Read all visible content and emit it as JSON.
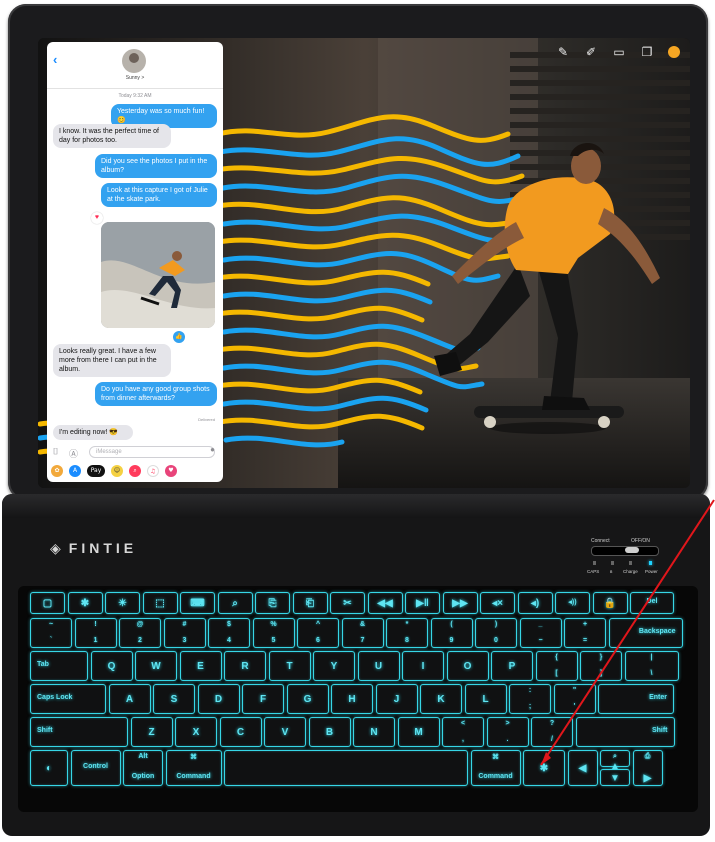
{
  "messages": {
    "contact_name": "Sunny >",
    "timestamp": "Today 9:32 AM",
    "bubbles": [
      {
        "text": "Yesterday was so much fun! 😊",
        "dir": "out"
      },
      {
        "text": "I know. It was the perfect time of day for photos too.",
        "dir": "in"
      },
      {
        "text": "Did you see the photos I put in the album?",
        "dir": "out"
      },
      {
        "text": "Look at this capture I got of Julie at the skate park.",
        "dir": "out"
      },
      {
        "text": "Looks really great. I have a few more from there I can put in the album.",
        "dir": "in"
      },
      {
        "text": "Do you have any good group shots from dinner afterwards?",
        "dir": "out"
      },
      {
        "text": "I'm editing now! 😎",
        "dir": "in"
      }
    ],
    "delivered": "Delivered",
    "compose_placeholder": "iMessage",
    "apps": [
      "photos-app",
      "app-store-app",
      "apple-pay-app",
      "memoji-app",
      "search-app",
      "music-app",
      "hearts-app"
    ],
    "apple_pay_label": "Pay"
  },
  "keyboard": {
    "brand": "FINTIE",
    "switch": {
      "connect": "Connect",
      "off_on": "OFF/ON"
    },
    "indicators": [
      "CAPS",
      "ʙ",
      "Charge",
      "Power"
    ],
    "rows": [
      [
        {
          "id": "f-home",
          "label": "▢"
        },
        {
          "id": "f-bright-down",
          "label": "✱"
        },
        {
          "id": "f-bright-up",
          "label": "☀"
        },
        {
          "id": "f-select",
          "label": "⬚"
        },
        {
          "id": "f-keyboard",
          "label": "⌨"
        },
        {
          "id": "f-search",
          "label": "⌕"
        },
        {
          "id": "f-copy",
          "label": "⎘"
        },
        {
          "id": "f-paste",
          "label": "⎗"
        },
        {
          "id": "f-cut",
          "label": "✂"
        },
        {
          "id": "f-prev",
          "label": "◀◀"
        },
        {
          "id": "f-play",
          "label": "▶‖"
        },
        {
          "id": "f-next",
          "label": "▶▶"
        },
        {
          "id": "f-mute",
          "label": "◂×"
        },
        {
          "id": "f-vol-down",
          "label": "◂)"
        },
        {
          "id": "f-vol-up",
          "label": "◂))"
        },
        {
          "id": "f-lock",
          "label": "🔒"
        },
        {
          "id": "del",
          "label": "Del"
        }
      ],
      [
        {
          "id": "backtick",
          "top": "~",
          "bot": "`"
        },
        {
          "id": "1",
          "top": "!",
          "bot": "1"
        },
        {
          "id": "2",
          "top": "@",
          "bot": "2"
        },
        {
          "id": "3",
          "top": "#",
          "bot": "3"
        },
        {
          "id": "4",
          "top": "$",
          "bot": "4"
        },
        {
          "id": "5",
          "top": "%",
          "bot": "5"
        },
        {
          "id": "6",
          "top": "^",
          "bot": "6"
        },
        {
          "id": "7",
          "top": "&",
          "bot": "7"
        },
        {
          "id": "8",
          "top": "*",
          "bot": "8"
        },
        {
          "id": "9",
          "top": "(",
          "bot": "9"
        },
        {
          "id": "0",
          "top": ")",
          "bot": "0"
        },
        {
          "id": "minus",
          "top": "_",
          "bot": "−"
        },
        {
          "id": "equal",
          "top": "+",
          "bot": "="
        },
        {
          "id": "backspace",
          "label": "Backspace"
        }
      ],
      [
        {
          "id": "tab",
          "label": "Tab"
        },
        {
          "id": "q",
          "label": "Q"
        },
        {
          "id": "w",
          "label": "W"
        },
        {
          "id": "e",
          "label": "E"
        },
        {
          "id": "r",
          "label": "R"
        },
        {
          "id": "t",
          "label": "T"
        },
        {
          "id": "y",
          "label": "Y"
        },
        {
          "id": "u",
          "label": "U"
        },
        {
          "id": "i",
          "label": "I"
        },
        {
          "id": "o",
          "label": "O"
        },
        {
          "id": "p",
          "label": "P"
        },
        {
          "id": "lbrace",
          "top": "{",
          "bot": "["
        },
        {
          "id": "rbrace",
          "top": "}",
          "bot": "]"
        },
        {
          "id": "pipe",
          "top": "|",
          "bot": "\\"
        }
      ],
      [
        {
          "id": "caps",
          "label": "Caps Lock"
        },
        {
          "id": "a",
          "label": "A"
        },
        {
          "id": "s",
          "label": "S"
        },
        {
          "id": "d",
          "label": "D"
        },
        {
          "id": "f",
          "label": "F"
        },
        {
          "id": "g",
          "label": "G"
        },
        {
          "id": "h",
          "label": "H"
        },
        {
          "id": "j",
          "label": "J"
        },
        {
          "id": "k",
          "label": "K"
        },
        {
          "id": "l",
          "label": "L"
        },
        {
          "id": "semicolon",
          "top": ":",
          "bot": ";"
        },
        {
          "id": "quote",
          "top": "\"",
          "bot": "'"
        },
        {
          "id": "enter",
          "label": "Enter"
        }
      ],
      [
        {
          "id": "lshift",
          "label": "Shift"
        },
        {
          "id": "z",
          "label": "Z"
        },
        {
          "id": "x",
          "label": "X"
        },
        {
          "id": "c",
          "label": "C"
        },
        {
          "id": "v",
          "label": "V"
        },
        {
          "id": "b",
          "label": "B"
        },
        {
          "id": "n",
          "label": "N"
        },
        {
          "id": "m",
          "label": "M"
        },
        {
          "id": "comma",
          "top": "<",
          "bot": ","
        },
        {
          "id": "period",
          "top": ">",
          "bot": "."
        },
        {
          "id": "slash",
          "top": "?",
          "bot": "/"
        },
        {
          "id": "rshift",
          "label": "Shift"
        }
      ],
      [
        {
          "id": "fn",
          "label": "◐"
        },
        {
          "id": "control",
          "label": "Control"
        },
        {
          "id": "option",
          "label": "Option",
          "top": "Alt"
        },
        {
          "id": "lcommand",
          "label": "Command",
          "top": "⌘"
        },
        {
          "id": "space",
          "label": ""
        },
        {
          "id": "rcommand",
          "label": "Command",
          "top": "⌘"
        },
        {
          "id": "bluetooth",
          "label": "✱"
        },
        {
          "id": "left",
          "label": "◀"
        },
        {
          "id": "up",
          "label": "▲",
          "top": "⌕"
        },
        {
          "id": "down",
          "label": "▼"
        },
        {
          "id": "right",
          "label": "▶",
          "top": "⎙"
        }
      ]
    ]
  },
  "colors": {
    "backlight": "#37d6e6",
    "bubble_out": "#33a2f0",
    "bubble_in": "#e5e5ea",
    "shirt": "#f29a1f",
    "wave_yellow": "#f5b800",
    "wave_blue": "#1aa3f0",
    "annotation": "#e0161b"
  },
  "toolbar_icons": [
    "pen-icon",
    "marker-icon",
    "eraser-icon",
    "layers-icon",
    "color-dot"
  ]
}
